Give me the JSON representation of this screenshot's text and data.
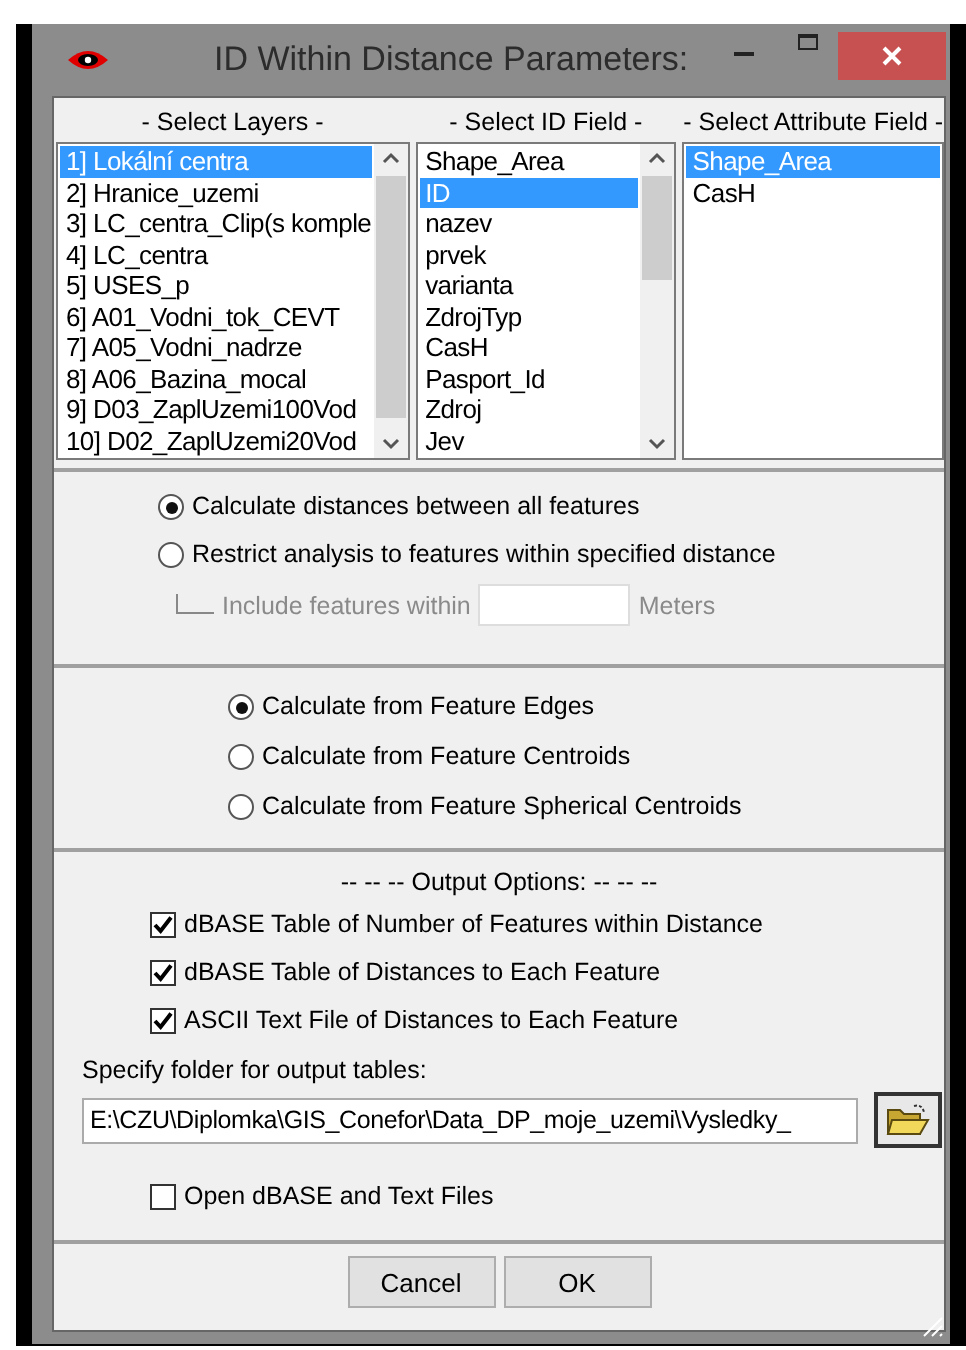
{
  "window": {
    "title": "ID Within Distance Parameters:"
  },
  "lists": [
    {
      "header": "- Select Layers -",
      "scrollbar": true,
      "items": [
        {
          "label": "1] Lokální centra",
          "selected": true
        },
        {
          "label": "2] Hranice_uzemi",
          "selected": false
        },
        {
          "label": "3] LC_centra_Clip(s komple",
          "selected": false
        },
        {
          "label": "4] LC_centra",
          "selected": false
        },
        {
          "label": "5] USES_p",
          "selected": false
        },
        {
          "label": "6] A01_Vodni_tok_CEVT",
          "selected": false
        },
        {
          "label": "7] A05_Vodni_nadrze",
          "selected": false
        },
        {
          "label": "8] A06_Bazina_mocal",
          "selected": false
        },
        {
          "label": "9] D03_ZaplUzemi100Vod",
          "selected": false
        },
        {
          "label": "10] D02_ZaplUzemi20Vod",
          "selected": false
        }
      ]
    },
    {
      "header": "- Select ID Field -",
      "scrollbar": true,
      "items": [
        {
          "label": "Shape_Area",
          "selected": false
        },
        {
          "label": "ID",
          "selected": true
        },
        {
          "label": "nazev",
          "selected": false
        },
        {
          "label": "prvek",
          "selected": false
        },
        {
          "label": "varianta",
          "selected": false
        },
        {
          "label": "ZdrojTyp",
          "selected": false
        },
        {
          "label": "CasH",
          "selected": false
        },
        {
          "label": "Pasport_Id",
          "selected": false
        },
        {
          "label": "Zdroj",
          "selected": false
        },
        {
          "label": "Jev",
          "selected": false
        }
      ]
    },
    {
      "header": "- Select Attribute Field -",
      "scrollbar": false,
      "items": [
        {
          "label": "Shape_Area",
          "selected": true
        },
        {
          "label": "CasH",
          "selected": false
        }
      ]
    }
  ],
  "distance_options": [
    {
      "label": "Calculate distances between all features",
      "selected": true
    },
    {
      "label": "Restrict analysis to features within specified distance",
      "selected": false
    }
  ],
  "distance_limit": {
    "label": "Include features within",
    "unit": "Meters",
    "disabled": true
  },
  "calculation_options": [
    {
      "label": "Calculate from Feature Edges",
      "selected": true
    },
    {
      "label": "Calculate from Feature Centroids",
      "selected": false
    },
    {
      "label": "Calculate from Feature Spherical Centroids",
      "selected": false
    }
  ],
  "output": {
    "title": "-- -- -- Output Options: -- -- --",
    "checks": [
      {
        "label": "dBASE Table of Number of Features within Distance",
        "checked": true
      },
      {
        "label": "dBASE Table of Distances to Each Feature",
        "checked": true
      },
      {
        "label": "ASCII Text File of Distances to Each Feature",
        "checked": true
      }
    ],
    "folder_label": "Specify folder for output tables:",
    "folder_path": "E:\\CZU\\Diplomka\\GIS_Conefor\\Data_DP_moje_uzemi\\Vysledky_",
    "open_files": {
      "label": "Open dBASE and Text Files",
      "checked": false
    }
  },
  "buttons": [
    "Cancel",
    "OK"
  ]
}
